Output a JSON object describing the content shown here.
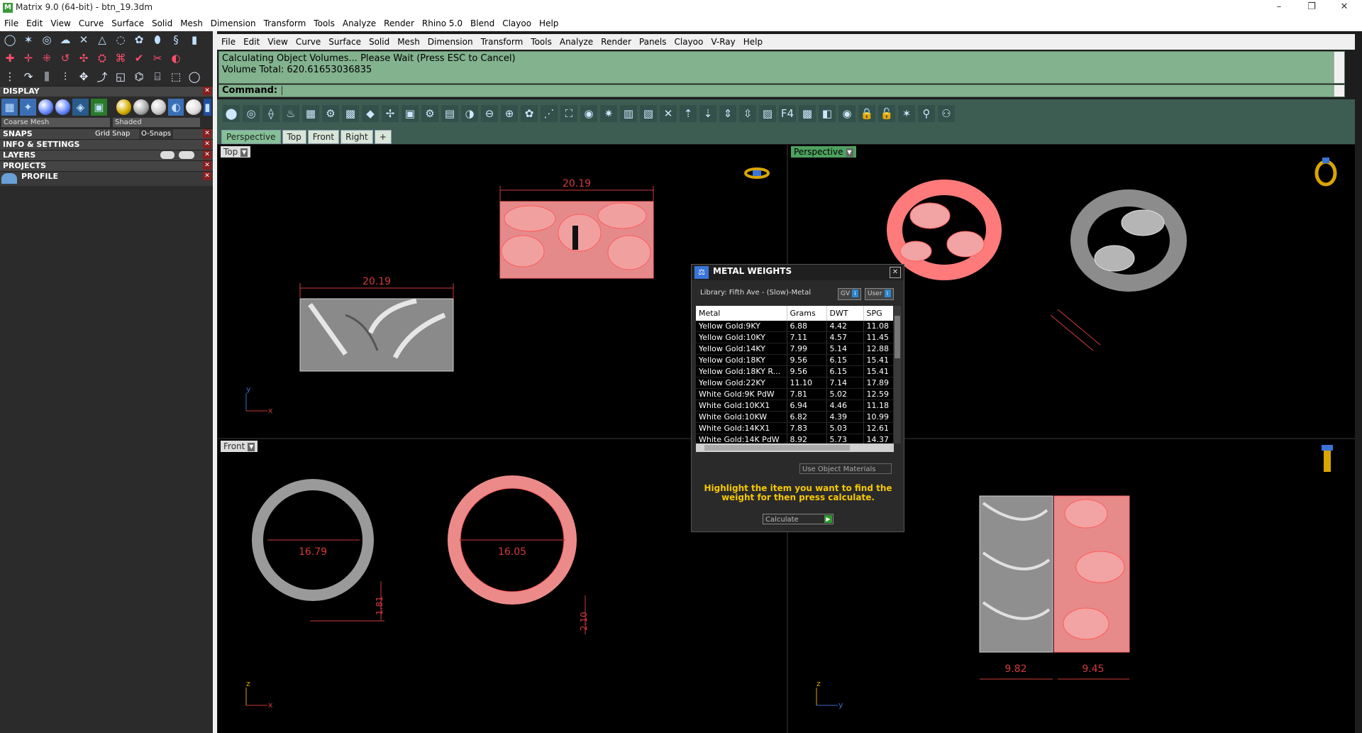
{
  "window": {
    "title": "Matrix 9.0 (64-bit) - btn_19.3dm",
    "controls": [
      "–",
      "❐",
      "✕"
    ]
  },
  "main_menu": [
    "File",
    "Edit",
    "View",
    "Curve",
    "Surface",
    "Solid",
    "Mesh",
    "Dimension",
    "Transform",
    "Tools",
    "Analyze",
    "Render",
    "Rhino 5.0",
    "Blend",
    "Clayoo",
    "Help"
  ],
  "left_panel": {
    "sections": {
      "display": "DISPLAY",
      "snaps": "SNAPS",
      "info": "INFO & SETTINGS",
      "layers": "LAYERS",
      "projects": "PROJECTS",
      "profile": "PROFILE"
    },
    "mesh_select": "Coarse Mesh",
    "shade_select": "Shaded",
    "grid_snap": "Grid Snap",
    "osnaps": "O-Snaps"
  },
  "sub_menu": [
    "File",
    "Edit",
    "View",
    "Curve",
    "Surface",
    "Solid",
    "Mesh",
    "Dimension",
    "Transform",
    "Tools",
    "Analyze",
    "Render",
    "Panels",
    "Clayoo",
    "V-Ray",
    "Help"
  ],
  "command": {
    "history_line1": "Calculating Object Volumes... Please Wait (Press ESC to Cancel)",
    "history_line2": "Volume Total: 620.61653036835",
    "prompt": "Command:"
  },
  "view_tabs": [
    "Perspective",
    "Top",
    "Front",
    "Right",
    "+"
  ],
  "viewports": {
    "top": {
      "label": "Top",
      "dims": [
        "20.19",
        "20.19"
      ],
      "axes": [
        "y",
        "x"
      ]
    },
    "perspective": {
      "label": "Perspective"
    },
    "front": {
      "label": "Front",
      "dims": [
        "16.79",
        "16.05",
        "1.81",
        "2.10"
      ],
      "axes": [
        "z",
        "x"
      ]
    },
    "right": {
      "dims": [
        "9.82",
        "9.45"
      ],
      "axes": [
        "z",
        "y"
      ]
    }
  },
  "metal_weights": {
    "title": "METAL WEIGHTS",
    "library": "Library: Fifth Ave - (Slow)-Metal",
    "gv_btn": "GV",
    "user_btn": "User",
    "columns": [
      "Metal",
      "Grams",
      "DWT",
      "SPG"
    ],
    "rows": [
      [
        "Yellow Gold:9KY",
        "6.88",
        "4.42",
        "11.08"
      ],
      [
        "Yellow Gold:10KY",
        "7.11",
        "4.57",
        "11.45"
      ],
      [
        "Yellow Gold:14KY",
        "7.99",
        "5.14",
        "12.88"
      ],
      [
        "Yellow Gold:18KY",
        "9.56",
        "6.15",
        "15.41"
      ],
      [
        "Yellow Gold:18KY R...",
        "9.56",
        "6.15",
        "15.41"
      ],
      [
        "Yellow Gold:22KY",
        "11.10",
        "7.14",
        "17.89"
      ],
      [
        "White Gold:9K PdW",
        "7.81",
        "5.02",
        "12.59"
      ],
      [
        "White Gold:10KX1",
        "6.94",
        "4.46",
        "11.18"
      ],
      [
        "White Gold:10KW",
        "6.82",
        "4.39",
        "10.99"
      ],
      [
        "White Gold:14KX1",
        "7.83",
        "5.03",
        "12.61"
      ],
      [
        "White Gold:14K PdW",
        "8.92",
        "5.73",
        "14.37"
      ]
    ],
    "use_object": "Use Object Materials",
    "help": "Highlight the item you want to find the weight for then press calculate.",
    "calculate": "Calculate"
  }
}
